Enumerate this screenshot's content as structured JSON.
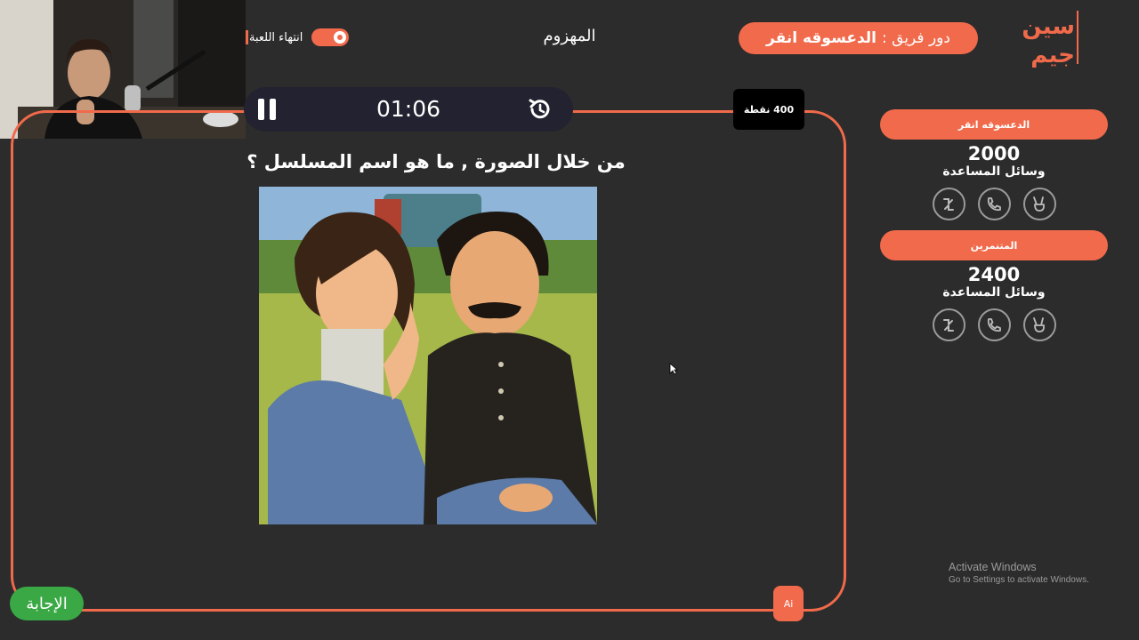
{
  "header": {
    "logo_text": "سين جيم",
    "turn_prefix": "دور فريق :",
    "turn_team": "الدعسوقه انقر",
    "loser_title": "المهزوم",
    "end_game_label": "انتهاء اللعبة"
  },
  "timer": {
    "time": "01:06",
    "pause_icon": "pause-icon",
    "reset_icon": "history-icon"
  },
  "question": {
    "points": "400 نقطة",
    "text": "من خلال الصورة , ما هو اسم المسلسل ؟",
    "image_description_icon": "question-illustration"
  },
  "teams": [
    {
      "name": "الدعسوقه انقر",
      "score": "2000",
      "aids_label": "وسائل المساعدة",
      "aids": [
        "two-answers-icon",
        "call-friend-icon",
        "victory-hand-icon"
      ]
    },
    {
      "name": "المتنمرين",
      "score": "2400",
      "aids_label": "وسائل المساعدة",
      "aids": [
        "two-answers-icon",
        "call-friend-icon",
        "victory-hand-icon"
      ]
    }
  ],
  "footer": {
    "answer_label": "الإجابة",
    "ai_label": "Ai"
  },
  "watermark": {
    "line1": "Activate Windows",
    "line2": "Go to Settings to activate Windows."
  },
  "colors": {
    "accent": "#f06a4b",
    "background": "#2c2c2c",
    "answer_green": "#3aa845",
    "timer_bg": "#222230"
  }
}
